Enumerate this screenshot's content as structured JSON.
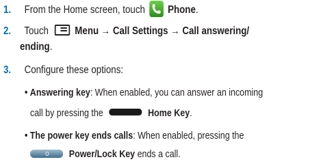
{
  "steps": [
    {
      "number": "1.",
      "pre": "From the Home screen, touch",
      "icon": "phone-icon",
      "bold": "Phone",
      "post": "."
    },
    {
      "number": "2.",
      "pre": "Touch",
      "icon": "menu-icon",
      "bold_line1": "Menu → Call Settings → Call answering/",
      "bold_line2": "ending",
      "post": "."
    },
    {
      "number": "3.",
      "text": "Configure these options:"
    }
  ],
  "options": [
    {
      "bullet": "•",
      "title": "Answering key",
      "line1": ": When enabled, you can answer an incoming",
      "line2_pre": "call by pressing the",
      "key_icon": "home-key-icon",
      "key_label": "Home Key",
      "post": "."
    },
    {
      "bullet": "•",
      "title": "The power key ends calls",
      "line1": ": When enabled, pressing the",
      "key_icon": "power-lock-key-icon",
      "key_label": "Power/Lock Key",
      "post": " ends a call."
    }
  ],
  "colors": {
    "step_number": "#0070bb",
    "text": "#231f20",
    "phone_icon": "#3fae2a"
  }
}
